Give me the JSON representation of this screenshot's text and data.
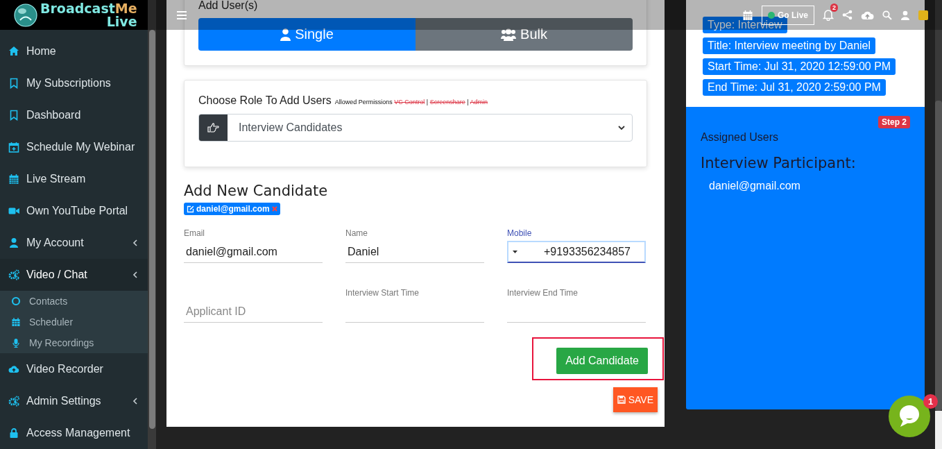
{
  "logo": {
    "part_1": "Broadcast",
    "part_2": "Me",
    "part_3": "Live"
  },
  "top_bar": {
    "go_live": "Go Live",
    "notification_count": "2"
  },
  "sidebar": {
    "items": [
      {
        "label": "Home",
        "selected": false,
        "has_submenu": false
      },
      {
        "label": "My Subscriptions",
        "selected": false,
        "has_submenu": false
      },
      {
        "label": "Dashboard",
        "selected": false,
        "has_submenu": false
      },
      {
        "label": "Schedule My Webinar",
        "selected": false,
        "has_submenu": false
      },
      {
        "label": "Live Stream",
        "selected": false,
        "has_submenu": false
      },
      {
        "label": "Own YouTube Portal",
        "selected": false,
        "has_submenu": false
      },
      {
        "label": "My Account",
        "selected": false,
        "has_submenu": true
      },
      {
        "label": "Video / Chat",
        "selected": true,
        "has_submenu": true,
        "expanded": true,
        "children": [
          {
            "label": "Contacts"
          },
          {
            "label": "Scheduler"
          },
          {
            "label": "My Recordings"
          }
        ]
      },
      {
        "label": "Video Recorder",
        "selected": false,
        "has_submenu": false
      },
      {
        "label": "Admin Settings",
        "selected": false,
        "has_submenu": true
      },
      {
        "label": "Access Management",
        "selected": false,
        "has_submenu": false
      }
    ]
  },
  "add_users": {
    "title": "Add User(s)",
    "tabs": [
      {
        "label": "Single",
        "selected": true
      },
      {
        "label": "Bulk",
        "selected": false
      }
    ]
  },
  "role": {
    "label": "Choose Role To Add Users",
    "permissions_label": "Allowed Permissions",
    "separator": "|",
    "permissions": [
      {
        "label": "VC Control",
        "allowed": false
      },
      {
        "label": "Screenshare",
        "allowed": false
      },
      {
        "label": "Admin",
        "allowed": false
      }
    ],
    "selected_role": "Interview Candidates"
  },
  "candidate": {
    "title": "Add New Candidate",
    "tag": "daniel@gmail.com",
    "fields": [
      {
        "kind": "text",
        "label": "Email",
        "value": "daniel@gmail.com",
        "focused": false
      },
      {
        "kind": "text",
        "label": "Name",
        "value": "Daniel",
        "focused": false
      },
      {
        "kind": "phone",
        "label": "Mobile",
        "value": "+9193356234857",
        "focused": true
      },
      {
        "kind": "text",
        "placeholder": "Applicant ID",
        "focused": false
      },
      {
        "kind": "text",
        "label": "Interview Start Time",
        "focused": false
      },
      {
        "kind": "text",
        "label": "Interview End Time",
        "focused": false
      }
    ],
    "add_button": "Add Candidate",
    "save_button": "SAVE"
  },
  "meeting": {
    "chips": [
      "Type: Interview",
      "Title: Interview meeting by Daniel",
      "Start Time: Jul 31, 2020 12:59:00 PM",
      "End Time: Jul 31, 2020 2:59:00 PM"
    ],
    "step_badge": "Step 2",
    "assigned_label": "Assigned Users",
    "participant_heading": "Interview Participant:",
    "participants": [
      "daniel@gmail.com"
    ]
  },
  "chat": {
    "badge": "1"
  }
}
